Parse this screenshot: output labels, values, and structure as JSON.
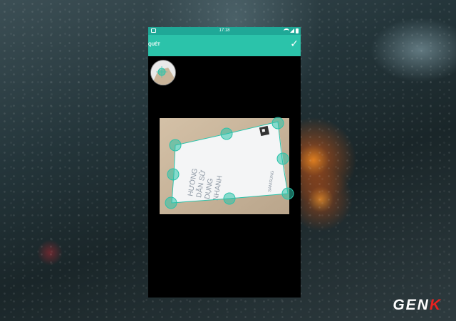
{
  "status_bar": {
    "time": "17:18",
    "icons": [
      "gallery-icon",
      "wifi-icon",
      "signal-icon",
      "battery-icon"
    ]
  },
  "app_bar": {
    "title": "QUÉT",
    "confirm_icon": "check-icon",
    "background_color": "#2bc3aa",
    "status_color": "#1fa897"
  },
  "scan": {
    "accent_color": "#2bc3aa",
    "document_lines": [
      "HƯỚNG",
      "DẪN SỬ",
      "DỤNG",
      "NHANH"
    ],
    "brand_text": "SAMSUNG",
    "handle_count": 8
  },
  "watermark": {
    "prefix": "GEN",
    "accent": "K",
    "accent_color": "#e8211f"
  }
}
